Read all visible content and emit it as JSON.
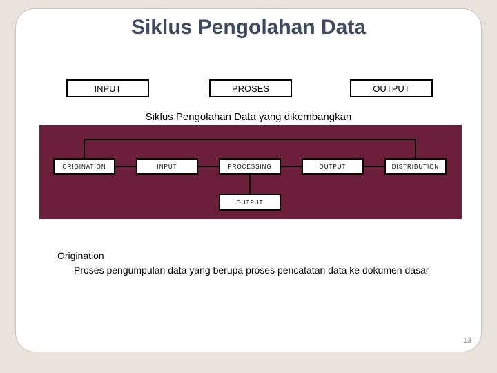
{
  "title": "Siklus Pengolahan Data",
  "top_boxes": {
    "input": "INPUT",
    "proses": "PROSES",
    "output": "OUTPUT"
  },
  "subtitle": "Siklus Pengolahan Data yang dikembangkan",
  "panel_boxes": {
    "origination": "ORIGINATION",
    "input": "INPUT",
    "processing": "PROCESSING",
    "output": "OUTPUT",
    "distribution": "DISTRIBUTION",
    "storage": "OUTPUT"
  },
  "definition": {
    "term": "Origination",
    "body": "Proses pengumpulan data yang berupa proses pencatatan data ke dokumen dasar"
  },
  "page_number": "13"
}
